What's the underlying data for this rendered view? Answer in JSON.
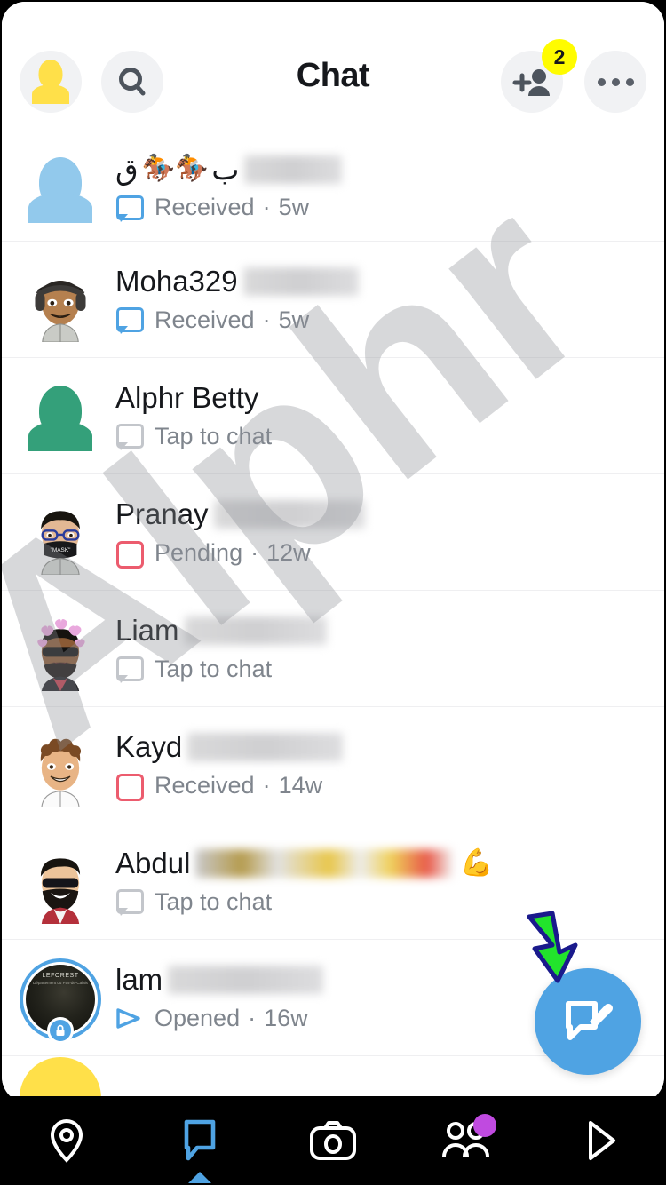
{
  "header": {
    "title": "Chat",
    "avatar_icon": "profile-avatar-icon",
    "search_icon": "search-icon",
    "add_friend_icon": "add-friend-icon",
    "add_friend_badge": "2",
    "more_icon": "more-options-icon",
    "badge_color": "#FFFC00"
  },
  "watermark": {
    "text": "Alphr"
  },
  "chats": [
    {
      "name": "ب",
      "name_suffix": "ق",
      "emoji": "🏇🏇",
      "blurred": true,
      "blur_width": 110,
      "status": "Received",
      "status_icon": "blue-chat-bubble-icon",
      "time": "5w",
      "separator": "·",
      "avatar": "blue-silhouette-avatar"
    },
    {
      "name": "Moha329",
      "blurred": true,
      "blur_width": 130,
      "status": "Received",
      "status_icon": "blue-chat-bubble-icon",
      "time": "5w",
      "separator": "·",
      "avatar": "bitmoji-headphones"
    },
    {
      "name": "Alphr Betty",
      "blurred": false,
      "blur_width": 0,
      "status": "Tap to chat",
      "status_icon": "gray-chat-bubble-icon",
      "time": "",
      "separator": "",
      "avatar": "green-silhouette-avatar"
    },
    {
      "name": "Pranay",
      "blurred": true,
      "blur_width": 170,
      "status": "Pending",
      "status_icon": "red-square-icon",
      "time": "12w",
      "separator": "·",
      "avatar": "bitmoji-mask-glasses"
    },
    {
      "name": "Liam",
      "blurred": true,
      "blur_width": 160,
      "status": "Tap to chat",
      "status_icon": "gray-chat-bubble-icon",
      "time": "",
      "separator": "",
      "avatar": "bitmoji-hearts-sunglasses"
    },
    {
      "name": "Kayd",
      "blurred": true,
      "blur_width": 175,
      "status": "Received",
      "status_icon": "red-square-icon",
      "time": "14w",
      "separator": "·",
      "avatar": "bitmoji-curly-hair"
    },
    {
      "name": "Abdul",
      "emoji": "💪",
      "blurred": true,
      "blur_width": 290,
      "blur_warm": true,
      "status": "Tap to chat",
      "status_icon": "gray-chat-bubble-icon",
      "time": "",
      "separator": "",
      "avatar": "bitmoji-beard-sunglasses"
    },
    {
      "name": "lam",
      "blurred": true,
      "blur_width": 175,
      "status": "Opened",
      "status_icon": "blue-arrow-icon",
      "time": "16w",
      "separator": "·",
      "avatar": "photo-story-locked",
      "photo_caption_line1": "LEFOREST",
      "photo_caption_line2": "Département du Pas-de-Calais"
    }
  ],
  "fab": {
    "icon": "new-chat-icon",
    "color": "#4fa3e3"
  },
  "annotation": {
    "arrow_icon": "green-arrow-pointer",
    "fill": "#22e32c",
    "stroke": "#1a1a8c"
  },
  "bottom_nav": {
    "items": [
      {
        "icon": "map-pin-icon",
        "active": false,
        "badge": false
      },
      {
        "icon": "chat-bubble-icon",
        "active": true,
        "badge": false
      },
      {
        "icon": "camera-icon",
        "active": false,
        "badge": false
      },
      {
        "icon": "friends-icon",
        "active": false,
        "badge": true
      },
      {
        "icon": "play-discover-icon",
        "active": false,
        "badge": false
      }
    ],
    "active_color": "#4fa3e3",
    "badge_color": "#c04ae0"
  }
}
